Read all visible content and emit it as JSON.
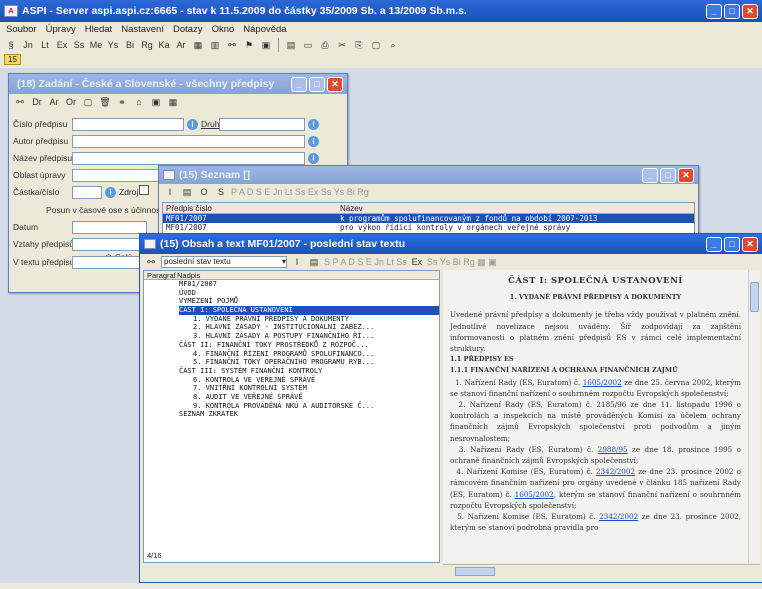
{
  "app": {
    "title": "ASPI - Server aspi.aspi.cz:6665 - stav k 11.5.2009 do částky 35/2009 Sb. a 13/2009 Sb.m.s.",
    "menu": [
      "Soubor",
      "Úpravy",
      "Hledat",
      "Nastavení",
      "Dotazy",
      "Okno",
      "Nápověda"
    ],
    "toolbar": [
      "§",
      "Jn",
      "Lt",
      "Ex",
      "Ss",
      "Me",
      "Ys",
      "Bi",
      "Rg",
      "Ka",
      "Ar"
    ],
    "tab_label": "15"
  },
  "search_window": {
    "title": "(18) Zadání - České a Slovenské - všechny předpisy",
    "fields": {
      "cislo": "Číslo předpisu",
      "druh": "Druh",
      "autor": "Autor předpisu",
      "nazev": "Název předpisu",
      "oblast": "Oblast úpravy",
      "castka": "Částka/číslo",
      "zdroj": "Zdroj",
      "posun": "Posun v časové ose s účinností",
      "datum": "Datum",
      "vztahy": "Vztahy předpisů",
      "ceclej": "Celý",
      "vtextu": "V textu předpisu"
    }
  },
  "seznam_window": {
    "title": "(15) Seznam []",
    "columns": [
      "Předpis číslo",
      "Název"
    ],
    "rows": [
      {
        "cislo": "MF01/2007",
        "nazev": "k programům spolufinancovaným z fondů na období 2007-2013",
        "selected": true
      },
      {
        "cislo": "MF01/2007",
        "nazev": "pro výkon řídicí kontroly v orgánech veřejné správy",
        "selected": false
      }
    ]
  },
  "text_window": {
    "title": "(15) Obsah a text MF01/2007 - poslední stav textu",
    "dropdown_value": "poslední stav textu",
    "columns": [
      "Paragraf",
      "Nadpis"
    ],
    "toc": [
      {
        "text": "MF01/2007",
        "indent": 0,
        "selected": false
      },
      {
        "text": "ÚVOD",
        "indent": 0,
        "selected": false
      },
      {
        "text": "VYMEZENÍ POJMŮ",
        "indent": 0,
        "selected": false
      },
      {
        "text": "ČÁST I: SPOLEČNÁ USTANOVENÍ",
        "indent": 0,
        "selected": true
      },
      {
        "text": "1. VYDANÉ PRÁVNÍ PŘEDPISY A DOKUMENTY",
        "indent": 1,
        "selected": false
      },
      {
        "text": "2. HLAVNÍ ZÁSADY - INSTITUCIONÁLNÍ ZABEZ...",
        "indent": 1,
        "selected": false
      },
      {
        "text": "3. HLAVNÍ ZÁSADY A POSTUPY FINANČNÍHO ŘÍ...",
        "indent": 1,
        "selected": false
      },
      {
        "text": "ČÁST II: FINANČNÍ TOKY PROSTŘEDKŮ Z ROZPOČ...",
        "indent": 0,
        "selected": false
      },
      {
        "text": "4. FINANČNÍ ŘÍZENÍ PROGRAMŮ SPOLUFINANCO...",
        "indent": 1,
        "selected": false
      },
      {
        "text": "5. FINANČNÍ TOKY OPERAČNÍHO PROGRAMU RYB...",
        "indent": 1,
        "selected": false
      },
      {
        "text": "ČÁST III: SYSTÉM FINANČNÍ KONTROLY",
        "indent": 0,
        "selected": false
      },
      {
        "text": "6. KONTROLA VE VEŘEJNÉ SPRÁVĚ",
        "indent": 1,
        "selected": false
      },
      {
        "text": "7. VNITŘNÍ KONTROLNÍ SYSTÉM",
        "indent": 1,
        "selected": false
      },
      {
        "text": "8. AUDIT VE VEŘEJNÉ SPRÁVĚ",
        "indent": 1,
        "selected": false
      },
      {
        "text": "9. KONTROLA PROVÁDĚNÁ NKÚ A AUDITORSKÉ Č...",
        "indent": 1,
        "selected": false
      },
      {
        "text": "SEZNAM ZKRATEK",
        "indent": 0,
        "selected": false
      }
    ],
    "status": "4/16",
    "doc": {
      "heading": "ČÁST I: SPOLEČNÁ USTANOVENÍ",
      "subheading": "1. VYDANÉ PRÁVNÍ PŘEDPISY A DOKUMENTY",
      "intro": "Uvedené právní předpisy a dokumenty je třeba vždy používat v platném znění. Jednotlivé novelizace nejsou uváděny. Šíř zodpovídají za zajištění informovanosti o platném znění předpisů ES v rámci celé implementační struktury.",
      "s1": "1.1 PŘEDPISY ES",
      "s11": "1.1.1 FINANČNÍ NAŘÍZENÍ A OCHRANA FINANČNÍCH ZÁJMŮ",
      "p1a": "1. Nařízení Rady (ES, Euratom) č. ",
      "p1l": "1605/2002",
      "p1b": " ze dne 25. června 2002, kterým se stanoví finanční nařízení o souhrnném rozpočtu Evropských společenství;",
      "p2": "2. Nařízení Rady (ES, Euratom) č. 2185/96 ze dne 11. listopadu 1996 o kontrolách a inspekcích na místě prováděných Komisí za účelem ochrany finančních zájmů Evropských společenství proti podvodům a jiným nesrovnalostem;",
      "p3a": "3. Nařízení Rady (ES, Euratom) č. ",
      "p3l": "2988/95",
      "p3b": " ze dne 18. prosince 1995 o ochraně finančních zájmů Evropských společenství;",
      "p4a": "4. Nařízení Komise (ES, Euratom) č. ",
      "p4l": "2342/2002",
      "p4b": " ze dne 23. prosince 2002 o rámcovém finančním nařízení pro orgány uvedené v článku 185 nařízení Rady (ES, Euratom) č. ",
      "p4l2": "1605/2002",
      "p4c": ", kterým se stanoví finanční nařízení o souhrnném rozpočtu Evropských společenství;",
      "p5a": "5. Nařízení Komise (ES, Euratom) č. ",
      "p5l": "2342/2002",
      "p5b": " ze dne 23. prosince 2002, kterým se stanoví podrobná pravidla pro"
    }
  }
}
